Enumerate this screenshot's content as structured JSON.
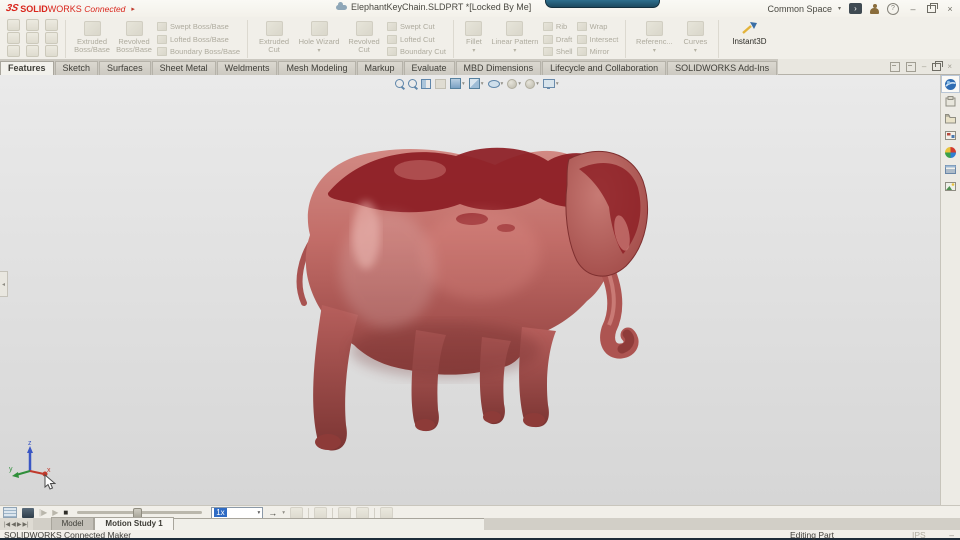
{
  "titlebar": {
    "logo_mark": "3S",
    "brand_solid": "SOLID",
    "brand_works": "WORKS",
    "brand_connected": "Connected",
    "expand_glyph": "▸",
    "document_title": "ElephantKeyChain.SLDPRT *[Locked By Me]",
    "space_selector": "Common Space",
    "space_caret": "▾",
    "share_glyph": "›",
    "help_glyph": "?",
    "minimize_glyph": "–",
    "close_glyph": "×"
  },
  "ribbon": {
    "boss": {
      "extruded": "Extruded Boss/Base",
      "revolved": "Revolved Boss/Base",
      "swept": "Swept Boss/Base",
      "lofted": "Lofted Boss/Base",
      "boundary": "Boundary Boss/Base"
    },
    "cut": {
      "extruded": "Extruded Cut",
      "hole_wizard": "Hole Wizard",
      "revolved": "Revolved Cut",
      "swept": "Swept Cut",
      "lofted": "Lofted Cut",
      "boundary": "Boundary Cut"
    },
    "pattern": {
      "fillet": "Fillet",
      "linear": "Linear Pattern",
      "rib": "Rib",
      "draft": "Draft",
      "shell": "Shell",
      "wrap": "Wrap",
      "intersect": "Intersect",
      "mirror": "Mirror"
    },
    "reference": {
      "reference": "Referenc...",
      "curves": "Curves"
    },
    "instant3d": "Instant3D",
    "caret": "▾"
  },
  "command_tabs": [
    "Features",
    "Sketch",
    "Surfaces",
    "Sheet Metal",
    "Weldments",
    "Mesh Modeling",
    "Markup",
    "Evaluate",
    "MBD Dimensions",
    "Lifecycle and Collaboration",
    "SOLIDWORKS Add-Ins"
  ],
  "tab_window": {
    "minimize": "–",
    "close": "×"
  },
  "motionbar": {
    "play_from_start_glyph": "|▶",
    "play_glyph": "▶",
    "stop_glyph": "■",
    "speed_value": "1x",
    "combo_caret": "▾",
    "advance_glyph": "→",
    "caret": "▾"
  },
  "bottom_tabs": {
    "nav": [
      "|◀",
      "◀",
      "▶",
      "▶|"
    ],
    "model": "Model",
    "motion_study": "Motion Study 1"
  },
  "statusbar": {
    "app": "SOLIDWORKS Connected Maker",
    "mode": "Editing Part",
    "units": "IPS",
    "expander": "–"
  },
  "triad": {
    "x": "x",
    "y": "y",
    "z": "z"
  },
  "theme": {
    "accent_red": "#d9261c",
    "selection_blue": "#2f6bc4",
    "model_red": "#b85c59",
    "model_dark_red": "#8c1d23",
    "viewport_gray": "#e2e2e2"
  }
}
